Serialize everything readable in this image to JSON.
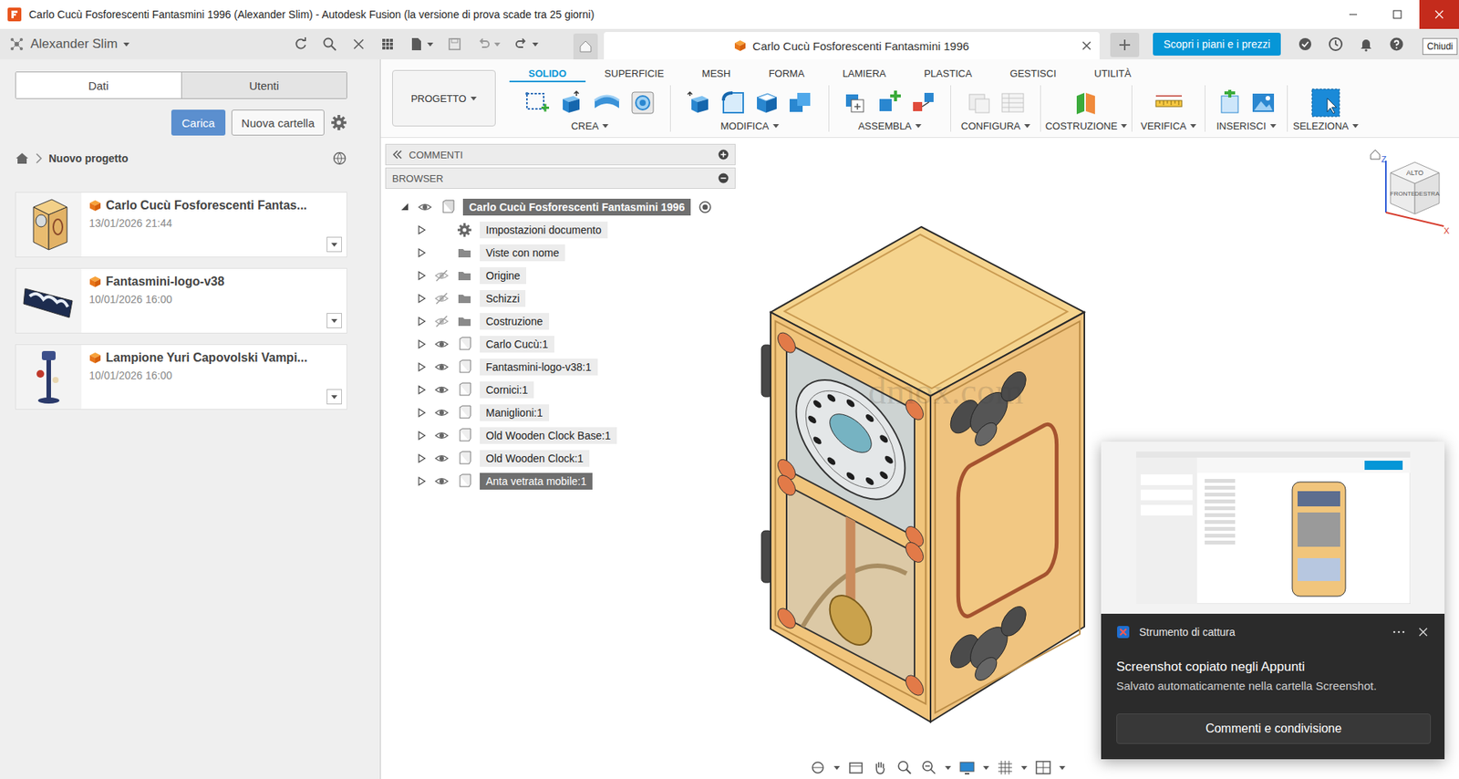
{
  "window": {
    "title": "Carlo Cucù Fosforescenti Fantasmini 1996 (Alexander Slim) - Autodesk Fusion (la versione di prova scade tra 25 giorni)",
    "close_tooltip": "Chiudi"
  },
  "data_panel": {
    "user": "Alexander Slim",
    "tabs": [
      {
        "label": "Dati",
        "selected": true
      },
      {
        "label": "Utenti",
        "selected": false
      }
    ],
    "upload_button": "Carica",
    "new_folder_button": "Nuova cartella",
    "breadcrumb": "Nuovo progetto",
    "files": [
      {
        "name": "Carlo Cucù Fosforescenti Fantas...",
        "date": "13/01/2026 21:44"
      },
      {
        "name": "Fantasmini-logo-v38",
        "date": "10/01/2026 16:00"
      },
      {
        "name": "Lampione Yuri Capovolski Vampi...",
        "date": "10/01/2026 16:00"
      }
    ]
  },
  "document_tabs": [
    {
      "title": "Carlo Cucù Fosforescenti Fantasmini 1996",
      "selected": true
    }
  ],
  "plans_button": "Scopri i piani e i prezzi",
  "toolbar": {
    "workspace": "PROGETTO",
    "tabs": [
      {
        "label": "SOLIDO",
        "selected": true
      },
      {
        "label": "SUPERFICIE",
        "selected": false
      },
      {
        "label": "MESH",
        "selected": false
      },
      {
        "label": "FORMA",
        "selected": false
      },
      {
        "label": "LAMIERA",
        "selected": false
      },
      {
        "label": "PLASTICA",
        "selected": false
      },
      {
        "label": "GESTISCI",
        "selected": false
      },
      {
        "label": "UTILITÀ",
        "selected": false
      }
    ],
    "groups": [
      "CREA",
      "MODIFICA",
      "ASSEMBLA",
      "CONFIGURA",
      "COSTRUZIONE",
      "VERIFICA",
      "INSERISCI",
      "SELEZIONA"
    ]
  },
  "browser": {
    "comments_title": "COMMENTI",
    "title": "BROWSER",
    "root": {
      "label": "Carlo Cucù Fosforescenti Fantasmini 1996",
      "expanded": true,
      "selected": true
    },
    "items": [
      {
        "label": "Impostazioni documento",
        "kind": "settings",
        "eye": "none",
        "expanded": false,
        "selected": false
      },
      {
        "label": "Viste con nome",
        "kind": "folder",
        "eye": "none",
        "expanded": false,
        "selected": false
      },
      {
        "label": "Origine",
        "kind": "folder",
        "eye": "hidden",
        "expanded": false,
        "selected": false
      },
      {
        "label": "Schizzi",
        "kind": "folder",
        "eye": "hidden",
        "expanded": false,
        "selected": false
      },
      {
        "label": "Costruzione",
        "kind": "folder",
        "eye": "hidden",
        "expanded": false,
        "selected": false
      },
      {
        "label": "Carlo Cucù:1",
        "kind": "component",
        "eye": "shown",
        "expanded": false,
        "selected": false
      },
      {
        "label": "Fantasmini-logo-v38:1",
        "kind": "component",
        "eye": "shown",
        "expanded": false,
        "selected": false
      },
      {
        "label": "Cornici:1",
        "kind": "component",
        "eye": "shown",
        "expanded": false,
        "selected": false
      },
      {
        "label": "Maniglioni:1",
        "kind": "component",
        "eye": "shown",
        "expanded": false,
        "selected": false
      },
      {
        "label": "Old Wooden Clock Base:1",
        "kind": "component",
        "eye": "shown",
        "expanded": false,
        "selected": false
      },
      {
        "label": "Old Wooden Clock:1",
        "kind": "component",
        "eye": "shown",
        "expanded": false,
        "selected": false
      },
      {
        "label": "Anta vetrata mobile:1",
        "kind": "component",
        "eye": "shown",
        "expanded": false,
        "selected": true
      }
    ]
  },
  "viewcube": {
    "top": "ALTO",
    "front": "FRONTE",
    "right": "DESTRA",
    "axis_z": "Z",
    "axis_x": "X"
  },
  "watermark": "dmox.com",
  "notification": {
    "app": "Strumento di cattura",
    "title": "Screenshot copiato negli Appunti",
    "body": "Salvato automaticamente nella cartella Screenshot.",
    "button": "Commenti e condivisione"
  }
}
